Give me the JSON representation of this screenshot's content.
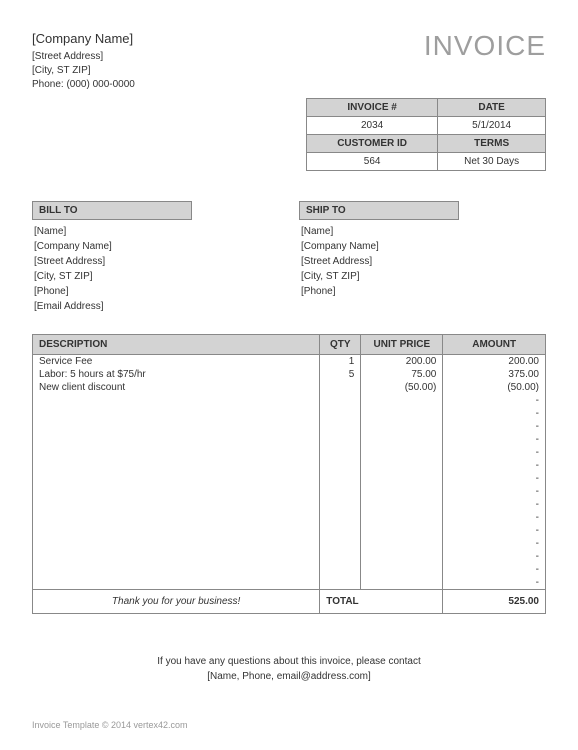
{
  "company": {
    "name": "[Company Name]",
    "street": "[Street Address]",
    "city": "[City, ST  ZIP]",
    "phone_label": "Phone: (000) 000-0000"
  },
  "title": "INVOICE",
  "meta": {
    "invoice_num_label": "INVOICE #",
    "invoice_num": "2034",
    "date_label": "DATE",
    "date": "5/1/2014",
    "customer_id_label": "CUSTOMER ID",
    "customer_id": "564",
    "terms_label": "TERMS",
    "terms": "Net 30 Days"
  },
  "bill_to": {
    "header": "BILL TO",
    "lines": [
      "[Name]",
      "[Company Name]",
      "[Street Address]",
      "[City, ST  ZIP]",
      "[Phone]",
      "[Email Address]"
    ]
  },
  "ship_to": {
    "header": "SHIP TO",
    "lines": [
      "[Name]",
      "[Company Name]",
      "[Street Address]",
      "[City, ST  ZIP]",
      "[Phone]"
    ]
  },
  "columns": {
    "description": "DESCRIPTION",
    "qty": "QTY",
    "unit_price": "UNIT PRICE",
    "amount": "AMOUNT"
  },
  "items": [
    {
      "desc": "Service Fee",
      "qty": "1",
      "price": "200.00",
      "amount": "200.00"
    },
    {
      "desc": "Labor: 5 hours at $75/hr",
      "qty": "5",
      "price": "75.00",
      "amount": "375.00"
    },
    {
      "desc": "New client discount",
      "qty": "",
      "price": "(50.00)",
      "amount": "(50.00)"
    }
  ],
  "thanks": "Thank you for your business!",
  "total_label": "TOTAL",
  "total_value": "525.00",
  "footer": {
    "line1": "If you have any questions about this invoice, please contact",
    "line2": "[Name, Phone, email@address.com]"
  },
  "copyright": "Invoice Template © 2014 vertex42.com"
}
